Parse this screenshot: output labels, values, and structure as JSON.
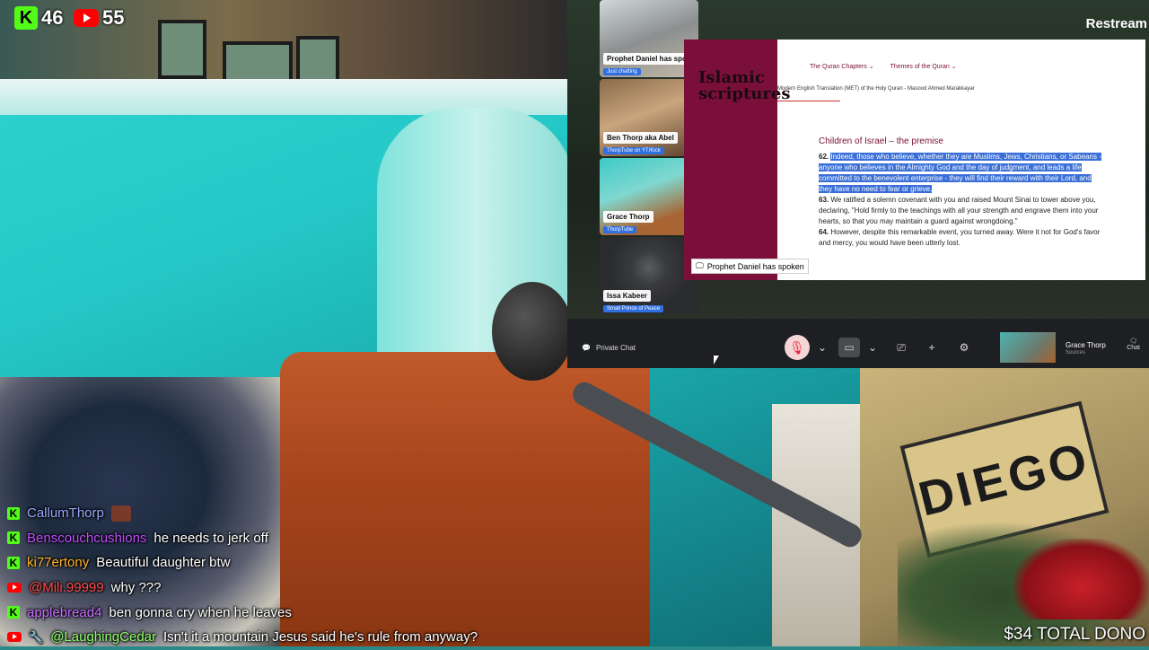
{
  "badges": {
    "kick_count": "46",
    "youtube_count": "55"
  },
  "conference": {
    "brand": "Restream",
    "participants": [
      {
        "name": "Prophet Daniel has spoken",
        "subtitle": "Just chatting"
      },
      {
        "name": "Ben Thorp aka Abel",
        "subtitle": "ThorpTube on YT/Kick"
      },
      {
        "name": "Grace Thorp",
        "subtitle": "ThorpTube"
      },
      {
        "name": "Issa Kabeer",
        "subtitle": "Small Prince of Peace"
      }
    ],
    "shared_page": {
      "logo": "Islamic scriptures",
      "nav": [
        "The Quran Chapters ⌄",
        "Themes of the Quran ⌄"
      ],
      "translation": "Modern English Translation (MET) of the Holy Quran - Masood Ahmed Marakkayar",
      "heading": "Children of Israel – the premise",
      "verse62_num": "62.",
      "verse62_text": "Indeed, those who believe, whether they are Muslims, Jews, Christians, or Sabeans - anyone who believes in the Almighty God and the day of judgment, and leads a life committed to the benevolent enterprise - they will find their reward with their Lord, and they have no need to fear or grieve.",
      "verse63_num": "63.",
      "verse63_text": "We ratified a solemn covenant with you and raised Mount Sinai to tower above you, declaring, \"Hold firmly to the teachings with all your strength and engrave them into your hearts, so that you may maintain a guard against wrongdoing.\"",
      "verse64_num": "64.",
      "verse64_text": "However, despite this remarkable event, you turned away. Were it not for God's favor and mercy, you would have been utterly lost."
    },
    "screen_caption": "Prophet Daniel has spoken",
    "toolbar": {
      "private_chat": "Private Chat",
      "self_name": "Grace Thorp",
      "self_sub": "Sources",
      "chat": "Chat"
    }
  },
  "chat": [
    {
      "platform": "kick",
      "user": "CallumThorp",
      "color": "#9aa7ff",
      "text": ""
    },
    {
      "platform": "kick",
      "user": "Benscouchcushions",
      "color": "#c04bff",
      "text": "he needs to jerk off"
    },
    {
      "platform": "kick",
      "user": "ki77ertony",
      "color": "#ffb428",
      "text": "Beautiful daughter btw"
    },
    {
      "platform": "youtube",
      "user": "@Mili.99999",
      "color": "#ff4a4a",
      "text": "why ???"
    },
    {
      "platform": "kick",
      "user": "applebread4",
      "color": "#c86bff",
      "text": "ben gonna cry when he leaves"
    },
    {
      "platform": "youtube",
      "user": "@LaughingCedar",
      "color": "#8cff6a",
      "text": "Isn't it a mountain Jesus said he's rule from anyway?"
    }
  ],
  "donations": "$34 TOTAL DONO"
}
